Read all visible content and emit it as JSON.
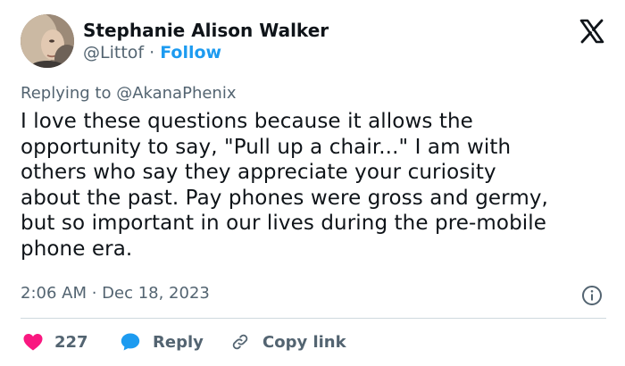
{
  "author": {
    "name": "Stephanie Alison Walker",
    "handle": "@Littof",
    "separator": " · ",
    "follow_label": "Follow"
  },
  "reply_to": "Replying to @AkanaPhenix",
  "body_lines": [
    "I love these questions because it allows the",
    "opportunity to say, \"Pull up a chair...\" I am with",
    "others who say they appreciate your curiosity",
    "about the past. Pay phones were gross and germy,",
    "but so important in our lives during the pre-mobile",
    "phone era."
  ],
  "timestamp": "2:06 AM · Dec 18, 2023",
  "actions": {
    "like_count": "227",
    "reply_label": "Reply",
    "copy_label": "Copy link"
  },
  "icons": {
    "avatar": "avatar-photo",
    "logo": "x-logo-icon",
    "info": "info-icon",
    "like": "heart-icon",
    "reply": "speech-bubble-icon",
    "copy": "link-icon"
  },
  "colors": {
    "text": "#0f1419",
    "muted": "#536471",
    "accent": "#1d9bf0",
    "like": "#f91880",
    "divider": "#cfd9de"
  }
}
